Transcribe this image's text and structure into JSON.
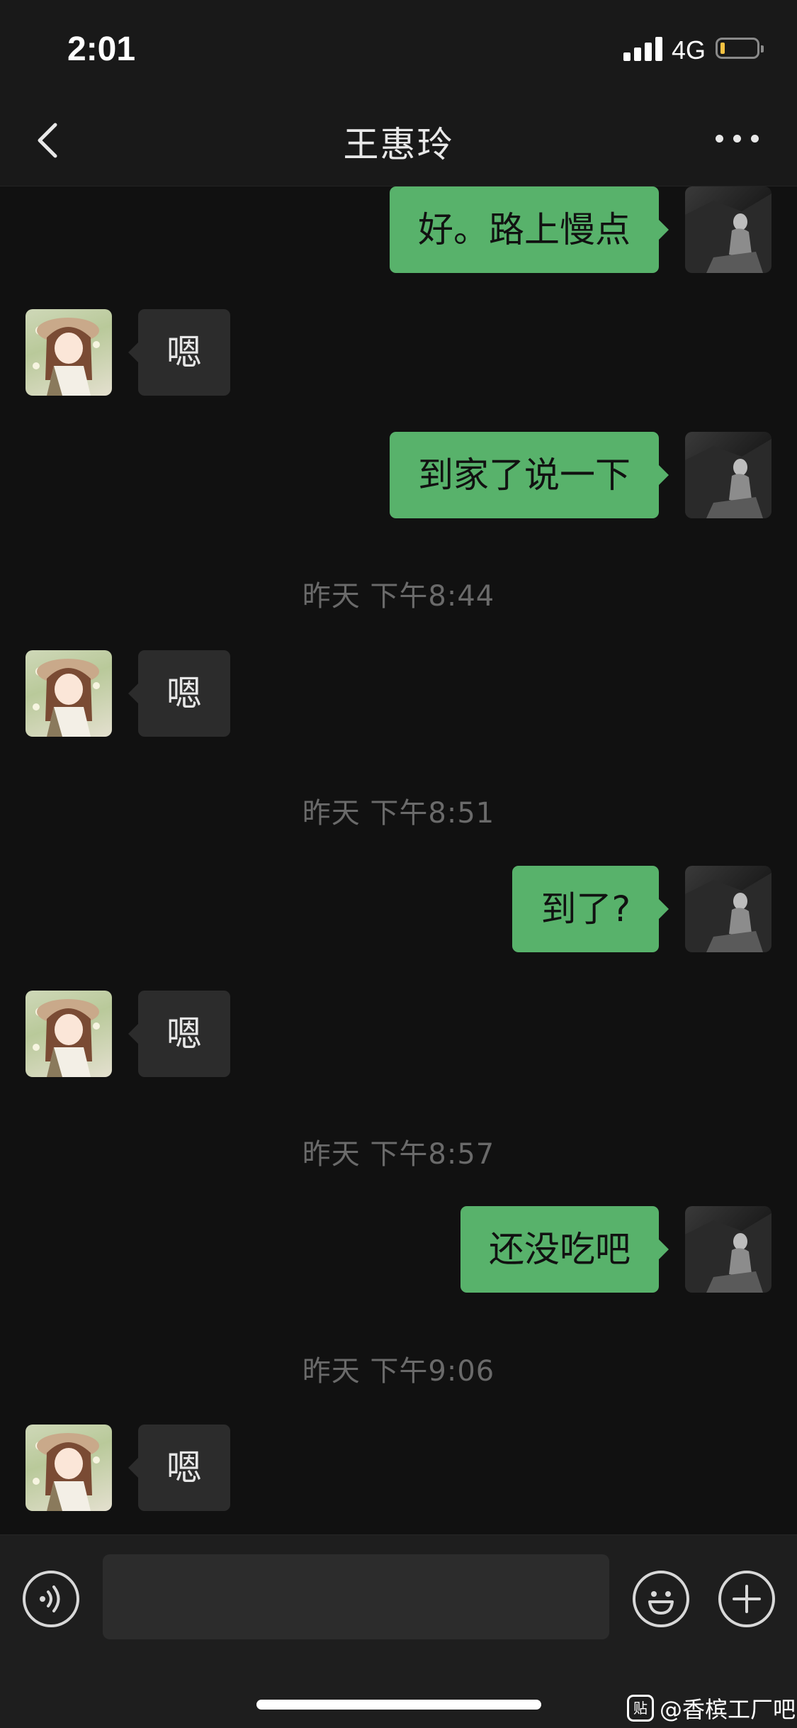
{
  "status_bar": {
    "time": "2:01",
    "network": "4G",
    "signal_icon": "signal-bars-icon",
    "battery_icon": "battery-low-icon",
    "battery_level": 0.1
  },
  "nav": {
    "title": "王惠玲",
    "back_icon": "chevron-left-icon",
    "more_icon": "ellipsis-icon"
  },
  "messages": [
    {
      "kind": "message",
      "from": "me",
      "text": "好。路上慢点"
    },
    {
      "kind": "message",
      "from": "her",
      "text": "嗯"
    },
    {
      "kind": "message",
      "from": "me",
      "text": "到家了说一下"
    },
    {
      "kind": "time",
      "text": "昨天 下午8:44"
    },
    {
      "kind": "message",
      "from": "her",
      "text": "嗯"
    },
    {
      "kind": "time",
      "text": "昨天 下午8:51"
    },
    {
      "kind": "message",
      "from": "me",
      "text": "到了?"
    },
    {
      "kind": "message",
      "from": "her",
      "text": "嗯"
    },
    {
      "kind": "time",
      "text": "昨天 下午8:57"
    },
    {
      "kind": "message",
      "from": "me",
      "text": "还没吃吧"
    },
    {
      "kind": "time",
      "text": "昨天 下午9:06"
    },
    {
      "kind": "message",
      "from": "her",
      "text": "嗯"
    }
  ],
  "input_bar": {
    "placeholder": "",
    "voice_icon": "voice-icon",
    "emoji_icon": "emoji-icon",
    "plus_icon": "plus-icon"
  },
  "watermark": {
    "logo_text": "贴",
    "text": "@香槟工厂吧"
  },
  "colors": {
    "background": "#111111",
    "bar_background": "#191919",
    "my_bubble": "#58b26b",
    "her_bubble": "#2c2c2c",
    "timestamp": "#6a6a6a"
  }
}
